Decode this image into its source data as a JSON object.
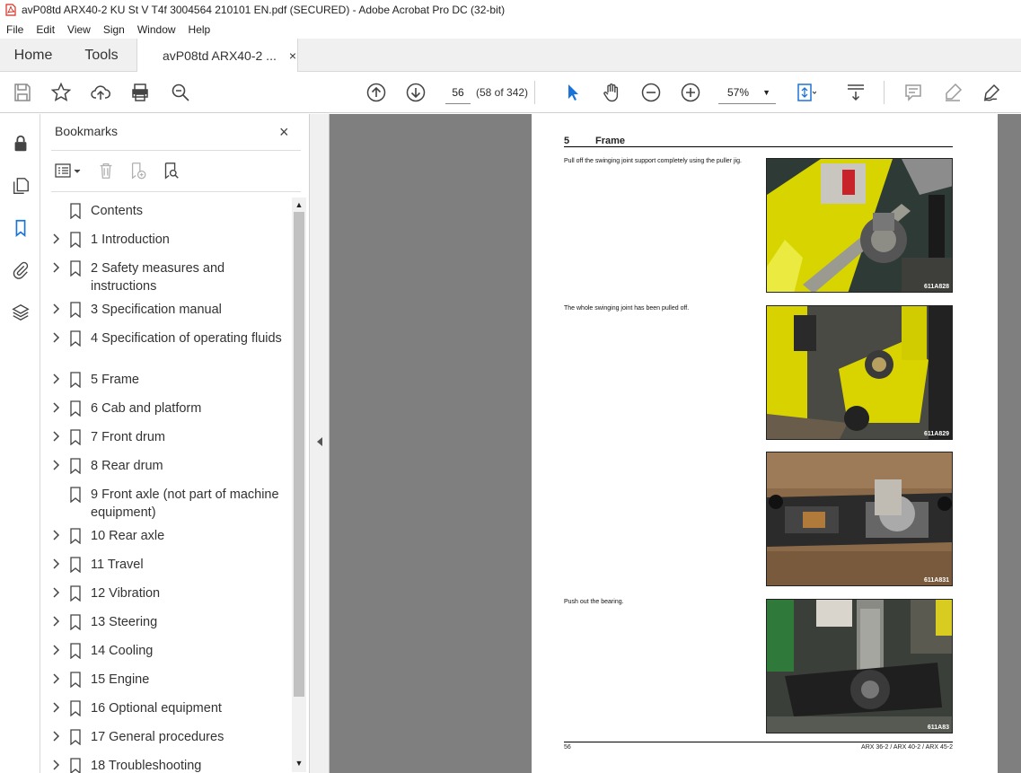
{
  "window": {
    "title": "avP08td ARX40-2 KU St V T4f 3004564 210101 EN.pdf (SECURED) - Adobe Acrobat Pro DC (32-bit)"
  },
  "menu": [
    "File",
    "Edit",
    "View",
    "Sign",
    "Window",
    "Help"
  ],
  "tabs": {
    "home": "Home",
    "tools": "Tools",
    "document": "avP08td ARX40-2 ...",
    "close": "×"
  },
  "toolbar": {
    "page_number": "56",
    "page_count": "(58 of 342)",
    "zoom": "57%"
  },
  "bookmarks": {
    "title": "Bookmarks",
    "close": "×",
    "items": [
      {
        "label": "Contents",
        "expandable": false
      },
      {
        "label": "1 Introduction",
        "expandable": true
      },
      {
        "label": "2 Safety measures and instructions",
        "expandable": true
      },
      {
        "label": "3 Specification manual",
        "expandable": true
      },
      {
        "label": "4 Specification of operating fluids",
        "expandable": true
      },
      {
        "label": "5 Frame",
        "expandable": true
      },
      {
        "label": "6 Cab and platform",
        "expandable": true
      },
      {
        "label": "7 Front drum",
        "expandable": true
      },
      {
        "label": "8 Rear drum",
        "expandable": true
      },
      {
        "label": "9 Front axle (not part of machine equipment)",
        "expandable": false
      },
      {
        "label": "10 Rear axle",
        "expandable": true
      },
      {
        "label": "11 Travel",
        "expandable": true
      },
      {
        "label": "12 Vibration",
        "expandable": true
      },
      {
        "label": "13 Steering",
        "expandable": true
      },
      {
        "label": "14 Cooling",
        "expandable": true
      },
      {
        "label": "15 Engine",
        "expandable": true
      },
      {
        "label": "16 Optional equipment",
        "expandable": true
      },
      {
        "label": "17 General procedures",
        "expandable": true
      },
      {
        "label": "18 Troubleshooting",
        "expandable": true
      }
    ]
  },
  "page": {
    "section_number": "5",
    "section_title": "Frame",
    "steps": [
      {
        "caption": "Pull off the swinging joint support completely using the puller jig.",
        "image_code": "611A828"
      },
      {
        "caption": "The whole swinging joint has been pulled off.",
        "image_code": "611A829"
      },
      {
        "caption": "",
        "image_code": "611A831"
      },
      {
        "caption": "Push out the bearing.",
        "image_code": "611A83"
      }
    ],
    "footer_left": "56",
    "footer_right": "ARX 36-2 / ARX 40-2 / ARX 45-2"
  }
}
